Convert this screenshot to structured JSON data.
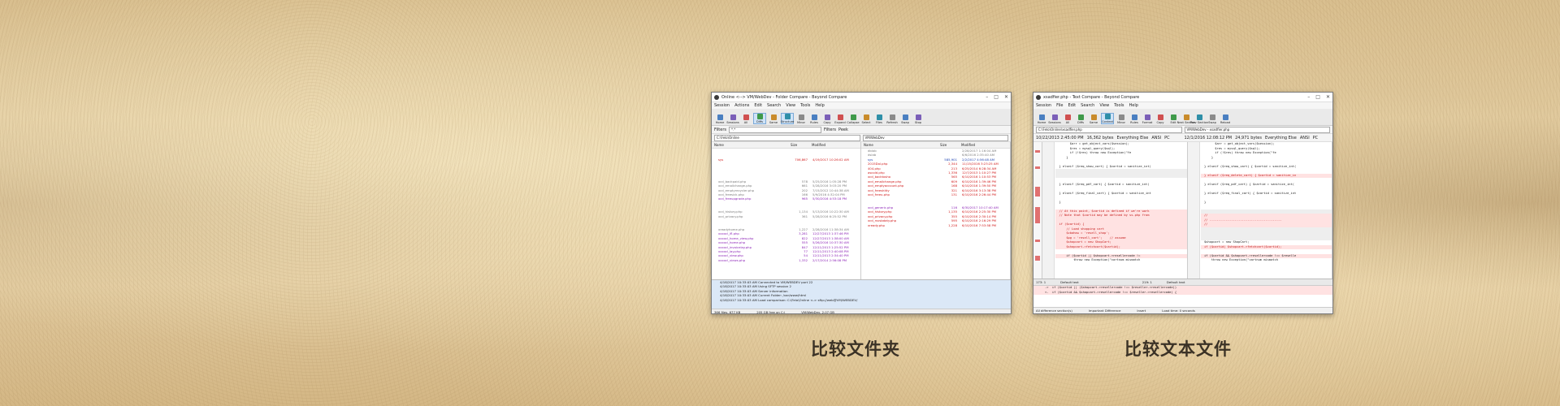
{
  "captions": {
    "folder_compare": "比较文件夹",
    "text_compare": "比较文本文件"
  },
  "folder_window": {
    "title": "Online <--> VM/WebDev - Folder Compare - Beyond Compare",
    "menu": [
      "Session",
      "Actions",
      "Edit",
      "Search",
      "View",
      "Tools",
      "Help"
    ],
    "toolbar": [
      "Home",
      "Sessions",
      "All",
      "Diffs",
      "Same",
      "Structure",
      "Minor",
      "Rules",
      "Copy",
      "Expand",
      "Collapse",
      "Select",
      "Files",
      "Refresh",
      "Swap",
      "Stop"
    ],
    "filters_label": "Filters",
    "filters_value": "*.*",
    "filters_btn": "Filters",
    "peek_btn": "Peek",
    "left_path": "C:\\Felo\\Online",
    "right_path": "VM/WebDev",
    "columns": {
      "name": "Name",
      "size": "Size",
      "modified": "Modified"
    },
    "left_rows": [
      {
        "name": "",
        "size": "",
        "date": "",
        "style": "gray"
      },
      {
        "name": "",
        "size": "",
        "date": "",
        "style": "gray"
      },
      {
        "name": "sys",
        "size": "706,867",
        "date": "4/19/2017 10:26:02 AM",
        "style": "red"
      },
      {
        "name": "",
        "size": "",
        "date": "",
        "style": "gray"
      },
      {
        "name": "",
        "size": "",
        "date": "",
        "style": "gray"
      },
      {
        "name": "",
        "size": "",
        "date": "",
        "style": "gray"
      },
      {
        "name": "",
        "size": "",
        "date": "",
        "style": "gray"
      },
      {
        "name": "xcd_backpaid.php",
        "size": "578",
        "date": "5/25/2016 1:05:28 PM",
        "style": "gray"
      },
      {
        "name": "xcd_emailchange.php",
        "size": "661",
        "date": "5/28/2016 3:03:20 PM",
        "style": "gray"
      },
      {
        "name": "xcd_emptyrecycler.php",
        "size": "202",
        "date": "7/15/2012 10:44:38 AM",
        "style": "gray"
      },
      {
        "name": "xcd_freesick.php",
        "size": "166",
        "date": "5/9/2016 4:32:04 PM",
        "style": "gray"
      },
      {
        "name": "xcd_freeupgrade.php",
        "size": "965",
        "date": "5/30/2016 4:53:18 PM",
        "style": "purple"
      },
      {
        "name": "",
        "size": "",
        "date": "",
        "style": "gray"
      },
      {
        "name": "",
        "size": "",
        "date": "",
        "style": "gray"
      },
      {
        "name": "xcd_history.php",
        "size": "1,134",
        "date": "5/13/2016 10:22:30 AM",
        "style": "gray"
      },
      {
        "name": "xcd_privacy.php",
        "size": "361",
        "date": "5/28/2016 6:25:52 PM",
        "style": "gray"
      },
      {
        "name": "",
        "size": "",
        "date": "",
        "style": "gray"
      },
      {
        "name": "",
        "size": "",
        "date": "",
        "style": "gray"
      },
      {
        "name": "xreadyhome.php",
        "size": "1,227",
        "date": "2/28/2016 11:38:34 AM",
        "style": "gray"
      },
      {
        "name": "xxxxcl_ifl.php",
        "size": "3,281",
        "date": "12/27/2013 1:37:46 PM",
        "style": "purple"
      },
      {
        "name": "xxxxcl_home_view.php",
        "size": "822",
        "date": "12/27/2013 1:38:00 AM",
        "style": "purple"
      },
      {
        "name": "xxxxcl_home.php",
        "size": "555",
        "date": "5/26/2016 10:37:30 AM",
        "style": "purple"
      },
      {
        "name": "xxxxcl_invoicelay.php",
        "size": "847",
        "date": "12/11/2013 1:25:52 PM",
        "style": "purple"
      },
      {
        "name": "xxxxcl_lay.php",
        "size": "77",
        "date": "12/11/2013 2:40:08 PM",
        "style": "purple"
      },
      {
        "name": "xxxxcl_view.php",
        "size": "54",
        "date": "12/11/2013 2:34:40 PM",
        "style": "purple"
      },
      {
        "name": "xxxxcl_views.php",
        "size": "1,332",
        "date": "2/17/2014 2:56:08 PM",
        "style": "purple"
      }
    ],
    "right_rows": [
      {
        "name": "dblob",
        "size": "",
        "date": "2/28/2017 1:16:04 AM",
        "style": "gray"
      },
      {
        "name": "dslab",
        "size": "",
        "date": "6/6/2016 2:35:40 AM",
        "style": "gray"
      },
      {
        "name": "sys",
        "size": "585,901",
        "date": "2/2/2017 4:56:48 AM",
        "style": "blue"
      },
      {
        "name": "2015Dol.php",
        "size": "2,344",
        "date": "11/15/2016 3:23:25 AM",
        "style": "red"
      },
      {
        "name": "404.php",
        "size": "213",
        "date": "6/25/2014 6:28:34 AM",
        "style": "red"
      },
      {
        "name": "ascold.php",
        "size": "1,336",
        "date": "12/7/2013 1:10:27 PM",
        "style": "red"
      },
      {
        "name": "xcd_backtosho",
        "size": "565",
        "date": "6/10/2016 1:10:53 PM",
        "style": "red"
      },
      {
        "name": "xcd_emailchange.php",
        "size": "609",
        "date": "6/10/2016 1:39:46 PM",
        "style": "red"
      },
      {
        "name": "xcd_emptyaccount.php",
        "size": "168",
        "date": "6/10/2016 1:39:50 PM",
        "style": "red"
      },
      {
        "name": "xcd_freeshitty",
        "size": "321",
        "date": "6/10/2016 3:13:38 PM",
        "style": "red"
      },
      {
        "name": "xcd_freeu.php",
        "size": "131",
        "date": "6/10/2016 2:26:44 PM",
        "style": "red"
      },
      {
        "name": "",
        "size": "",
        "date": "",
        "style": "gray"
      },
      {
        "name": "",
        "size": "",
        "date": "",
        "style": "gray"
      },
      {
        "name": "xcd_generic.php",
        "size": "116",
        "date": "6/30/2017 10:17:40 AM",
        "style": "purple"
      },
      {
        "name": "xcd_history.php",
        "size": "1,135",
        "date": "6/10/2016 2:25:30 PM",
        "style": "red"
      },
      {
        "name": "xcd_privacy.php",
        "size": "355",
        "date": "6/10/2016 2:30:14 PM",
        "style": "red"
      },
      {
        "name": "xcd_rsvsbdaty.php",
        "size": "595",
        "date": "6/10/2016 2:16:29 PM",
        "style": "red"
      },
      {
        "name": "xready.php",
        "size": "1,228",
        "date": "6/10/2016 7:53:58 PM",
        "style": "red"
      }
    ],
    "log_lines": [
      "4/18/2017 10:33:03 AM  Connected to VM/WEBDEV port 22",
      "4/18/2017 10:33:03 AM  Using SFTP session 2",
      "4/18/2017 10:33:03 AM  Server information",
      "4/18/2017 10:33:03 AM  Current Folder: /var/www/html",
      "4/18/2017 10:33:03 AM  Load comparison: C:\\Felo\\Online <-> sftp://web@VM/WEBDEV/"
    ],
    "status": [
      "366 files, 677 KB",
      "205 GB free on C:\\",
      "VM/WebDev, 2.07 GB"
    ]
  },
  "text_window": {
    "title": "xsadfier.php - Text Compare - Beyond Compare",
    "menu": [
      "Session",
      "File",
      "Edit",
      "Search",
      "View",
      "Tools",
      "Help"
    ],
    "toolbar": [
      "Home",
      "Sessions",
      "All",
      "Diffs",
      "Same",
      "Context",
      "Minor",
      "Rules",
      "Format",
      "Copy",
      "Edit",
      "Next Section",
      "Prev Section",
      "Swap",
      "Reload"
    ],
    "left_path": "C:\\Felo\\Online\\xsadfier.php",
    "right_path": "VM/WebDev - xsadfier.php",
    "left_info": [
      "10/22/2013 2:45:00 PM",
      "16,362 bytes",
      "Everything Else",
      "ANSI",
      "PC"
    ],
    "right_info": [
      "12/1/2016 12:08:12 PM",
      "24,971 bytes",
      "Everything Else",
      "ANSI",
      "PC"
    ],
    "left_code": [
      {
        "t": "        $arr = get_object_vars($session);",
        "s": ""
      },
      {
        "t": "        $res = mysql_query($sql);",
        "s": ""
      },
      {
        "t": "        if (!$res) throw new Exception(\"fe",
        "s": ""
      },
      {
        "t": "      }",
        "s": ""
      },
      {
        "t": "",
        "s": ""
      },
      {
        "t": "  } elseif ($req_show_cart) { $cartid = sanitize_int(",
        "s": ""
      },
      {
        "t": "",
        "s": "blank"
      },
      {
        "t": "",
        "s": "blank"
      },
      {
        "t": "",
        "s": ""
      },
      {
        "t": "  } elseif ($req_pdf_cart) { $cartid = sanitize_int(",
        "s": ""
      },
      {
        "t": "",
        "s": ""
      },
      {
        "t": "  } elseif ($req_final_cart) { $cartid = sanitize_int",
        "s": ""
      },
      {
        "t": "",
        "s": ""
      },
      {
        "t": "  }",
        "s": ""
      },
      {
        "t": "",
        "s": ""
      },
      {
        "t": "  // At this point, $cartid is defined if we're work",
        "s": "red"
      },
      {
        "t": "  // Note that $cartid may be defined by ss.php from",
        "s": "red"
      },
      {
        "t": "",
        "s": "diff"
      },
      {
        "t": "  if ($cartid) {",
        "s": "red"
      },
      {
        "t": "      // Load shopping cart",
        "s": "red"
      },
      {
        "t": "      $cbahow = 'resell_shop';",
        "s": "red"
      },
      {
        "t": "      $pg = 'resell_cart';    // assume",
        "s": "red"
      },
      {
        "t": "      $shopcart = new ShopCart;",
        "s": "red"
      },
      {
        "t": "      $shopcart->fetchcart($cartid);",
        "s": "red"
      },
      {
        "t": "",
        "s": ""
      },
      {
        "t": "      if ($cartid || $shopcart->resellercode != ",
        "s": "diff"
      },
      {
        "t": "          throw new Exception(\"cartnum mismatch",
        "s": ""
      }
    ],
    "right_code": [
      {
        "t": "        $arr = get_object_vars($session);",
        "s": ""
      },
      {
        "t": "        $res = mysql_query($sql);",
        "s": ""
      },
      {
        "t": "        if (!$res) throw new Exception(\"fe",
        "s": ""
      },
      {
        "t": "      }",
        "s": ""
      },
      {
        "t": "",
        "s": ""
      },
      {
        "t": "  } elseif ($req_show_cart) { $cartid = sanitize_int(",
        "s": ""
      },
      {
        "t": "",
        "s": ""
      },
      {
        "t": "  } elseif ($req_delete_cart) { $cartid = sanitize_in",
        "s": "red"
      },
      {
        "t": "",
        "s": ""
      },
      {
        "t": "  } elseif ($req_pdf_cart) { $cartid = sanitize_int(",
        "s": ""
      },
      {
        "t": "",
        "s": ""
      },
      {
        "t": "  } elseif ($req_final_cart) { $cartid = sanitize_int",
        "s": ""
      },
      {
        "t": "",
        "s": ""
      },
      {
        "t": "  }",
        "s": ""
      },
      {
        "t": "",
        "s": ""
      },
      {
        "t": "",
        "s": "blank"
      },
      {
        "t": "  //",
        "s": "red"
      },
      {
        "t": "  // ----------------------------------------",
        "s": "red"
      },
      {
        "t": "  //",
        "s": "red"
      },
      {
        "t": "",
        "s": "blank"
      },
      {
        "t": "",
        "s": "blank"
      },
      {
        "t": "",
        "s": "blank"
      },
      {
        "t": "  $shopcart = new ShopCart;",
        "s": ""
      },
      {
        "t": "  if ($cartid) $shopcart->fetchcart($cartid);",
        "s": "red"
      },
      {
        "t": "",
        "s": ""
      },
      {
        "t": "  if ($cartid && $shopcart->resellercode !== $reselle",
        "s": "diff"
      },
      {
        "t": "      throw new Exception(\"cartnum mismatch",
        "s": ""
      }
    ],
    "pos_left": "173: 1",
    "pos_right": "219: 1",
    "default_text": "Default text",
    "bottom_lines": [
      "->  if ($cartid || ($shopcart->resellercode !== $reseller->resellercode))",
      "<-  if ($cartid && $shopcart->resellercode !== $reseller->resellercode) {"
    ],
    "status": [
      "All difference section(s)",
      "Important Difference",
      "Insert",
      "Load time: 0 seconds"
    ]
  }
}
